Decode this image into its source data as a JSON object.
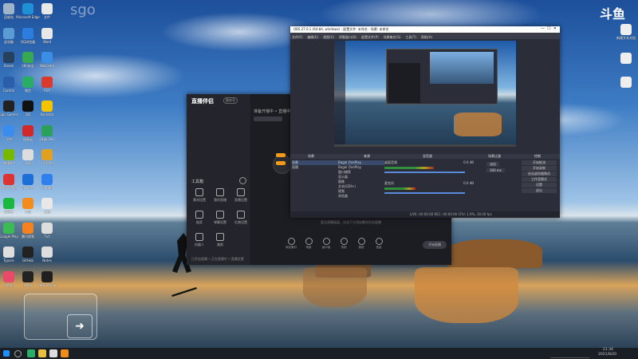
{
  "desktop": {
    "watermark_logo": "sgo",
    "brand_logo": "斗鱼",
    "icons": [
      {
        "label": "回收站",
        "color": "#9fb4c8"
      },
      {
        "label": "Microsoft Edge",
        "color": "#1f8fd6"
      },
      {
        "label": "文件",
        "color": "#e8e8e8"
      },
      {
        "label": "此电脑",
        "color": "#5a9bd4"
      },
      {
        "label": "QQ浏览器",
        "color": "#2d7de0"
      },
      {
        "label": "Word",
        "color": "#e8e8e8"
      },
      {
        "label": "Steam",
        "color": "#26415e"
      },
      {
        "label": "360安全",
        "color": "#36a852"
      },
      {
        "label": "WeGame",
        "color": "#3b8ee5"
      },
      {
        "label": "Control",
        "color": "#2a5ea8"
      },
      {
        "label": "微信",
        "color": "#2aae67"
      },
      {
        "label": "PDF",
        "color": "#d93a2b"
      },
      {
        "label": "Epic Games",
        "color": "#222"
      },
      {
        "label": "QQ",
        "color": "#111"
      },
      {
        "label": "Rockstar",
        "color": "#f5c400"
      },
      {
        "label": "飞书",
        "color": "#3c8cf0"
      },
      {
        "label": "网易云",
        "color": "#d12929"
      },
      {
        "label": "Edge Dev",
        "color": "#2aa05a"
      },
      {
        "label": "NVIDIA",
        "color": "#76b900"
      },
      {
        "label": "OBS",
        "color": "#ddd"
      },
      {
        "label": "Chrome",
        "color": "#e0a020"
      },
      {
        "label": "WPS Office",
        "color": "#d33"
      },
      {
        "label": "PDF Pro",
        "color": "#1d6fd8"
      },
      {
        "label": "Thunder",
        "color": "#2f80ed"
      },
      {
        "label": "爱奇艺",
        "color": "#1bb83f"
      },
      {
        "label": "斗鱼",
        "color": "#f28c1c"
      },
      {
        "label": "文档",
        "color": "#e8e8e8"
      },
      {
        "label": "Google Play",
        "color": "#3cba54"
      },
      {
        "label": "腾讯视频",
        "color": "#f5821f"
      },
      {
        "label": "Txt",
        "color": "#ddd"
      },
      {
        "label": "Typora",
        "color": "#ddd"
      },
      {
        "label": "GitHub",
        "color": "#222"
      },
      {
        "label": "Notes",
        "color": "#ddd"
      },
      {
        "label": "Setup",
        "color": "#e84a6a"
      },
      {
        "label": "Unity",
        "color": "#222"
      },
      {
        "label": "OBS Studio",
        "color": "#1f1f1f"
      }
    ],
    "right_icon": "新建文本文档"
  },
  "assistant": {
    "title": "直播伴侣",
    "badge": "版本号",
    "header_stream": "准备开播中 • 直播中",
    "tools_label": "工具箱",
    "menu": [
      "素材设置",
      "我的直播",
      "直播设置",
      "抽奖",
      "弹幕设置",
      "礼物设置",
      "机器人",
      "美颜"
    ],
    "hint": "暂无直播画面，点击下方添加素材开启直播",
    "footer": "已开启直播 • 正在直播中 • 直播设置",
    "start_btn": "开始直播",
    "bottom_tools": [
      "添加素材",
      "场景",
      "画中画",
      "录制",
      "美颜",
      "音量"
    ]
  },
  "obs": {
    "title": "OBS 27.0.1 (64-bit, windows) - 配置文件: 未命名 - 场景: 未命名",
    "menu": [
      "文件(F)",
      "编辑(E)",
      "视图(V)",
      "停靠窗口(D)",
      "配置文件(P)",
      "场景集合(S)",
      "工具(T)",
      "帮助(H)"
    ],
    "panels": {
      "scenes": "场景",
      "sources": "来源",
      "mixer": "混音器",
      "transitions": "场景过渡",
      "controls": "控制"
    },
    "scenes": [
      "场景",
      "直播"
    ],
    "sources": [
      "Bagel OnePlay",
      "Bagel OnePlay",
      "窗口捕获",
      "显示器",
      "图像",
      "文本(GDI+)",
      "视频",
      "浏览器"
    ],
    "mixer": [
      {
        "name": "桌面音频",
        "db": "0.0 dB",
        "level": 0.55
      },
      {
        "name": "麦克风",
        "db": "0.0 dB",
        "level": 0.35
      }
    ],
    "transition": {
      "type": "淡出",
      "duration": "300 ms"
    },
    "controls": [
      "开始推流",
      "开始录制",
      "启动虚拟摄像机",
      "工作室模式",
      "设置",
      "退出"
    ],
    "status": "LIVE: 00:00:00   REC: 00:00:00   CPU: 1.9%, 30.00 fps"
  },
  "taskbar": {
    "time": "21:36",
    "date": "2021/8/20"
  }
}
